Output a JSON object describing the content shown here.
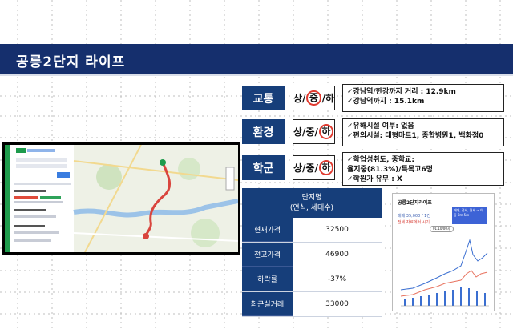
{
  "title": "공릉2단지 라이프",
  "categories": [
    {
      "label": "교통",
      "grade": [
        "상",
        "중",
        "하"
      ],
      "circled": 1,
      "info": [
        "✓강남역/한강까지 거리 : 12.9km",
        "✓강남역까지 : 15.1km"
      ]
    },
    {
      "label": "환경",
      "grade": [
        "상",
        "중",
        "하"
      ],
      "circled": 2,
      "info": [
        "✓유해시설 여부: 없음",
        "✓편의시설: 대형마트1, 종합병원1, 백화점0"
      ]
    },
    {
      "label": "학군",
      "grade": [
        "상",
        "중",
        "하"
      ],
      "circled": 2,
      "info": [
        "✓학업성취도, 중학교:",
        "율지중(81.3%)/특목고6명",
        "✓학원가 유무 : X"
      ]
    }
  ],
  "table": {
    "header_line1": "단지명",
    "header_line2": "(연식, 세대수)",
    "rows": [
      {
        "label": "현재가격",
        "value": "32500"
      },
      {
        "label": "전고가격",
        "value": "46900"
      },
      {
        "label": "하락률",
        "value": "-37%"
      },
      {
        "label": "최근실거래",
        "value": "33000"
      }
    ]
  },
  "mini_chart": {
    "title": "공릉2단지라이프",
    "subtitle": "매매 35,000 / 1건",
    "caption": "전세 자료에서 시기",
    "tooltip": "01.10/00시",
    "legend_box": "매매, 전세, 월세 → 이동  8m 5m"
  },
  "colors": {
    "navy": "#152f6d",
    "cell_blue": "#163e7a",
    "circle_red": "#e03a2f",
    "route_red": "#d9453d"
  }
}
